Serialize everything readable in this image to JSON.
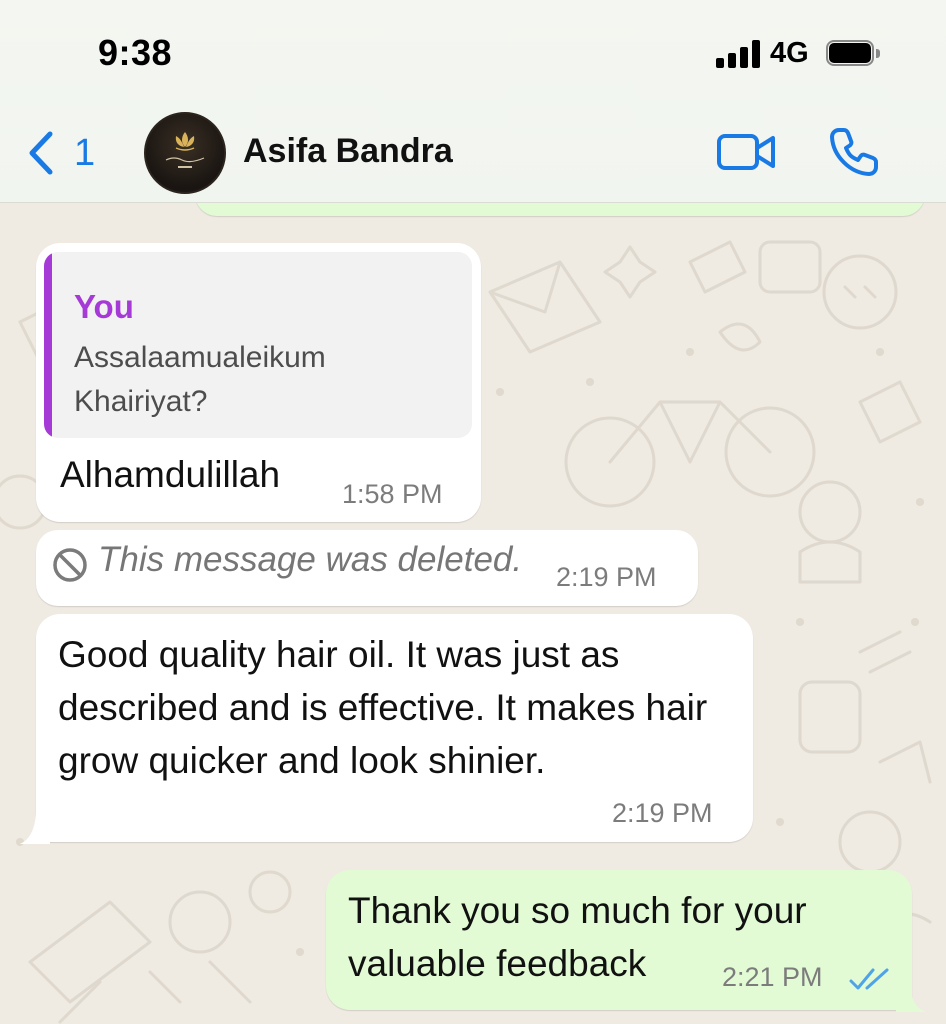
{
  "status_bar": {
    "time": "9:38",
    "network": "4G",
    "signal_icon": "signal-bars-icon",
    "battery_icon": "battery-icon"
  },
  "header": {
    "back_count": "1",
    "contact_name": "Asifa Bandra",
    "video_icon": "video-camera-icon",
    "call_icon": "phone-icon",
    "accent_color": "#1a7ae5"
  },
  "messages": [
    {
      "direction": "incoming",
      "quote_author": "You",
      "quote_text": "Assalaamualeikum Khairiyat?",
      "text": "Alhamdulillah",
      "time": "1:58 PM"
    },
    {
      "direction": "incoming",
      "deleted": true,
      "text": "This message was deleted.",
      "time": "2:19 PM"
    },
    {
      "direction": "incoming",
      "text": "Good quality hair oil. It was just as described and is effective. It makes hair grow quicker and look shinier.",
      "time": "2:19 PM"
    },
    {
      "direction": "outgoing",
      "text": "Thank you so much for your valuable feedback",
      "time": "2:21 PM",
      "status": "read"
    }
  ],
  "colors": {
    "incoming_bubble": "#ffffff",
    "outgoing_bubble": "#e2fbd5",
    "quote_accent": "#a53ad6",
    "read_ticks": "#4fa3e8",
    "chat_background": "#efeae2"
  }
}
